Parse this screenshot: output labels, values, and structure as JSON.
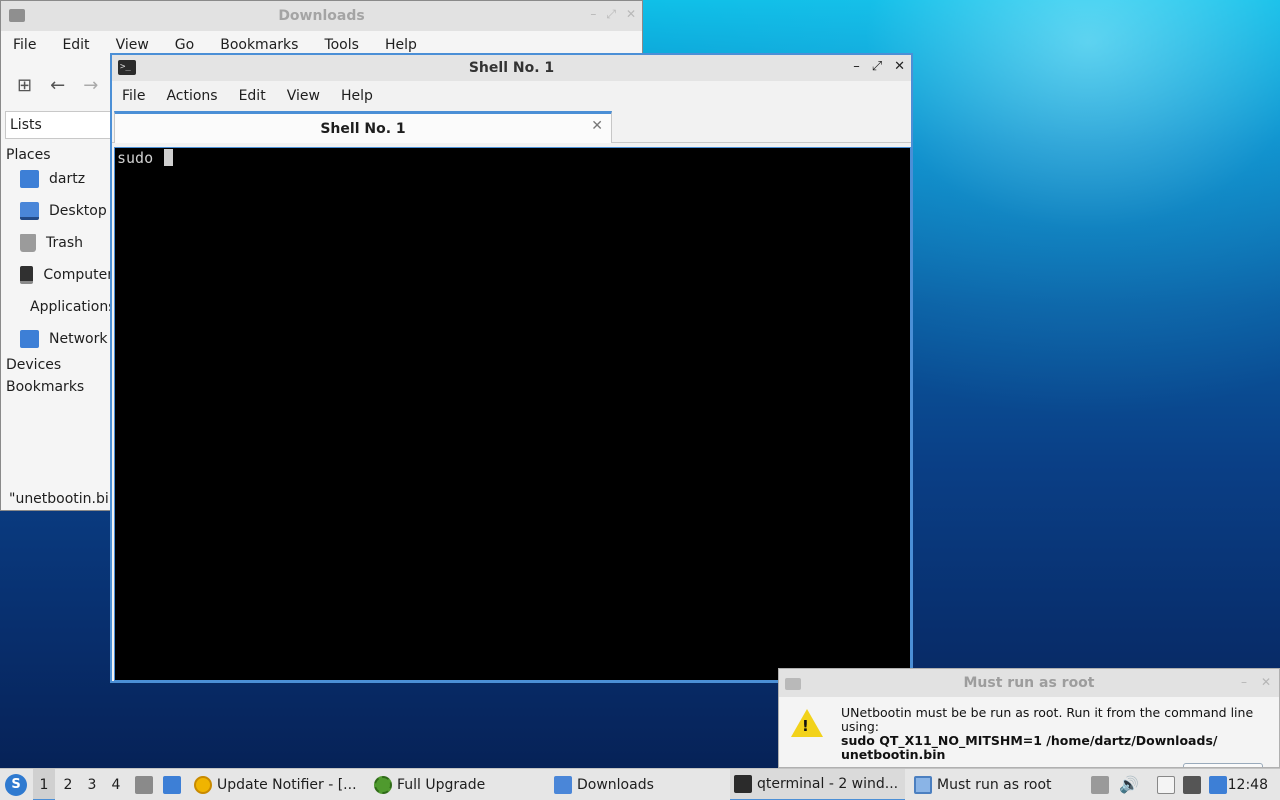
{
  "file_manager": {
    "title": "Downloads",
    "menu": [
      "File",
      "Edit",
      "View",
      "Go",
      "Bookmarks",
      "Tools",
      "Help"
    ],
    "toolbar": {
      "new_tab": "⊞",
      "back": "←",
      "forward": "→"
    },
    "side_pane_mode": "Lists",
    "sections": {
      "places": "Places",
      "devices": "Devices",
      "bookmarks": "Bookmarks"
    },
    "places": [
      "dartz",
      "Desktop",
      "Trash",
      "Computer",
      "Applications",
      "Network"
    ],
    "status": "\"unetbootin.bin\""
  },
  "terminal": {
    "title": "Shell No. 1",
    "icon_text": ">_",
    "menu": [
      "File",
      "Actions",
      "Edit",
      "View",
      "Help"
    ],
    "tab_label": "Shell No. 1",
    "tab_close": "✕",
    "prompt_text": "sudo ",
    "controls": {
      "minimize": "–",
      "maximize": "⤢",
      "close": "✕"
    }
  },
  "dialog": {
    "title": "Must run as root",
    "message_line1": "UNetbootin must be be run as root. Run it from the command line using:",
    "command_line1": "sudo QT_X11_NO_MITSHM=1 /home/dartz/Downloads/",
    "command_line2": "unetbootin.bin",
    "warning_mark": "!"
  },
  "taskbar": {
    "start_glyph": "S",
    "workspaces": [
      "1",
      "2",
      "3",
      "4"
    ],
    "active_workspace": "1",
    "tasks": [
      {
        "label": "Update Notifier - [...",
        "icon": "update-notifier-icon"
      },
      {
        "label": "Full Upgrade",
        "icon": "gear-icon"
      },
      {
        "label": "Downloads",
        "icon": "folder-icon"
      },
      {
        "label": "qterminal - 2 wind...",
        "icon": "terminal-icon"
      },
      {
        "label": "Must run as root",
        "icon": "dialog-icon"
      }
    ],
    "clock": "12:48"
  }
}
